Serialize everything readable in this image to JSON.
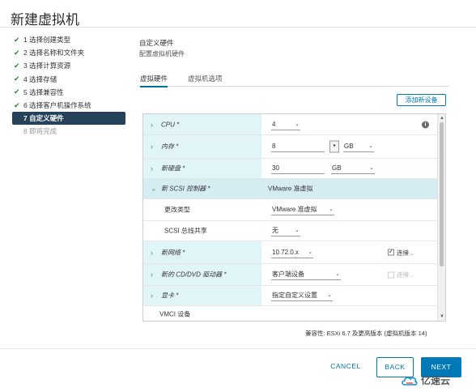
{
  "window": {
    "title": "新建虚拟机"
  },
  "steps": [
    {
      "label": "1 选择创建类型",
      "state": "done"
    },
    {
      "label": "2 选择名称和文件夹",
      "state": "done"
    },
    {
      "label": "3 选择计算资源",
      "state": "done"
    },
    {
      "label": "4 选择存储",
      "state": "done"
    },
    {
      "label": "5 选择兼容性",
      "state": "done"
    },
    {
      "label": "6 选择客户机操作系统",
      "state": "done"
    },
    {
      "label": "7 自定义硬件",
      "state": "active"
    },
    {
      "label": "8 即将完成",
      "state": "pending"
    }
  ],
  "section": {
    "title": "自定义硬件",
    "subtitle": "配置虚拟机硬件"
  },
  "tabs": [
    {
      "label": "虚拟硬件",
      "active": true
    },
    {
      "label": "虚拟机选项",
      "active": false
    }
  ],
  "add_device_label": "添加新设备",
  "hardware": {
    "cpu": {
      "label": "CPU *",
      "value": "4"
    },
    "memory": {
      "label": "内存 *",
      "value": "8",
      "unit": "GB"
    },
    "disk": {
      "label": "新硬盘 *",
      "value": "30",
      "unit": "GB"
    },
    "scsi": {
      "label": "新 SCSI 控制器 *",
      "value": "VMware 准虚拟"
    },
    "change_type": {
      "label": "更改类型",
      "value": "VMware 准虚拟"
    },
    "bus_sharing": {
      "label": "SCSI 总线共享",
      "value": "无"
    },
    "network": {
      "label": "新网络 *",
      "value": "10.72.0.x",
      "connect_label": "连接...",
      "connected": true
    },
    "cdrom": {
      "label": "新的 CD/DVD 驱动器 *",
      "value": "客户端设备",
      "connect_label": "连接...",
      "connected": false
    },
    "video": {
      "label": "显卡 *",
      "value": "指定自定义设置"
    },
    "vmci": {
      "label": "VMCI 设备"
    }
  },
  "compatibility": "兼容性: ESXi 6.7 及更高版本 (虚拟机版本 14)",
  "footer": {
    "cancel": "CANCEL",
    "back": "BACK",
    "next": "NEXT"
  },
  "watermark": "亿速云",
  "colors": {
    "accent": "#0079b8",
    "active_step_bg": "#26425a",
    "row_label_bg": "#e1f4f8",
    "row_highlight_bg": "#d5ecf2"
  }
}
